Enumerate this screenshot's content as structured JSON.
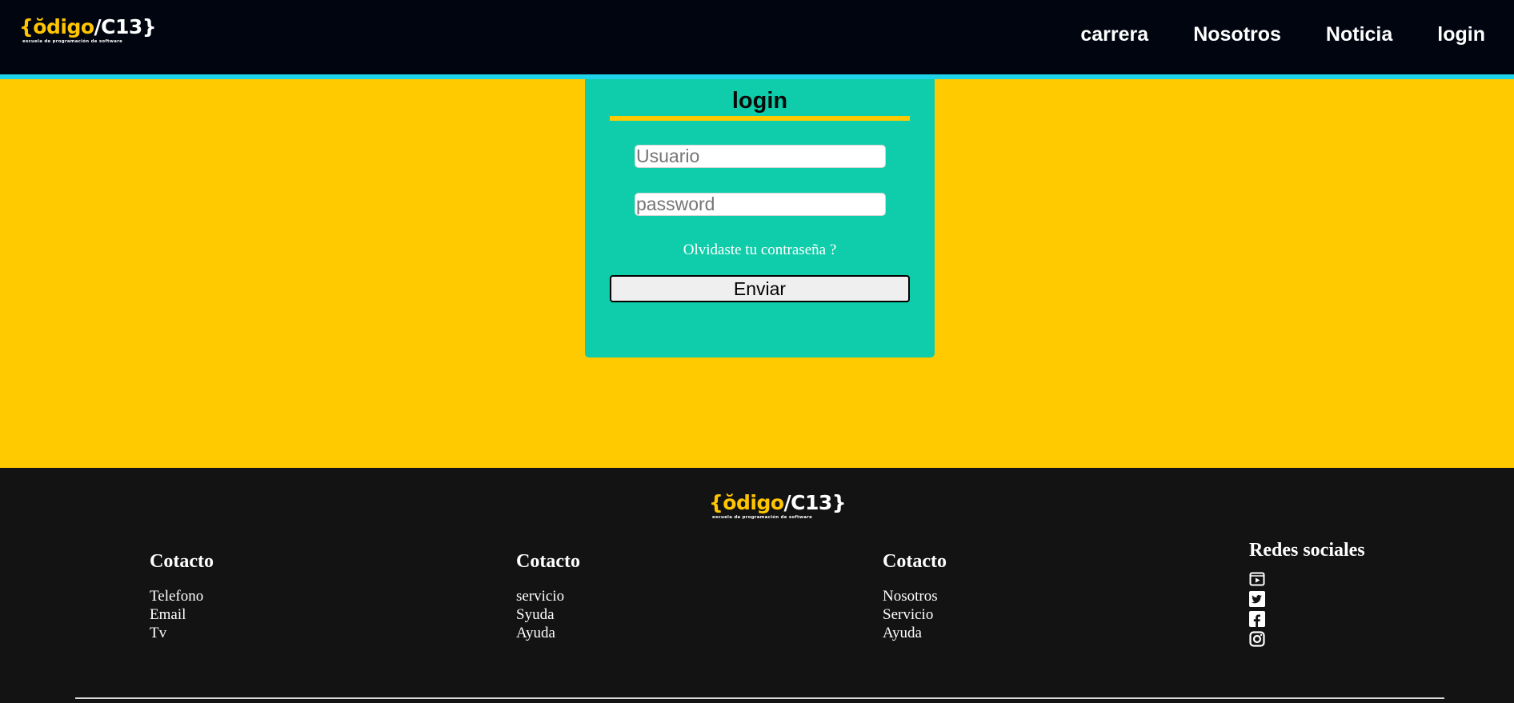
{
  "brand": {
    "logo_main_accent": "{ŏdigo",
    "logo_main_rest": "/C13}",
    "logo_tagline": "escuela de programación de software",
    "accent_color": "#ffc500"
  },
  "header": {
    "nav": [
      {
        "label": "carrera"
      },
      {
        "label": "Nosotros"
      },
      {
        "label": "Noticia"
      },
      {
        "label": "login"
      }
    ],
    "background": "#000510",
    "border_color": "#1fd4e8"
  },
  "login": {
    "title": "login",
    "username_placeholder": "Usuario",
    "password_placeholder": "password",
    "forgot_label": "Olvidaste tu contraseña ?",
    "submit_label": "Enviar",
    "card_color": "#0fcdaa",
    "page_color": "#ffcb00"
  },
  "footer": {
    "columns": [
      {
        "heading": "Cotacto",
        "links": [
          "Telefono",
          "Email",
          "Tv"
        ]
      },
      {
        "heading": "Cotacto",
        "links": [
          "servicio",
          "Syuda",
          "Ayuda"
        ]
      },
      {
        "heading": "Cotacto",
        "links": [
          "Nosotros",
          "Servicio",
          "Ayuda"
        ]
      }
    ],
    "social": {
      "heading": "Redes sociales",
      "icons": [
        "youtube-icon",
        "twitter-icon",
        "facebook-icon",
        "instagram-icon"
      ]
    },
    "background": "#131313"
  }
}
